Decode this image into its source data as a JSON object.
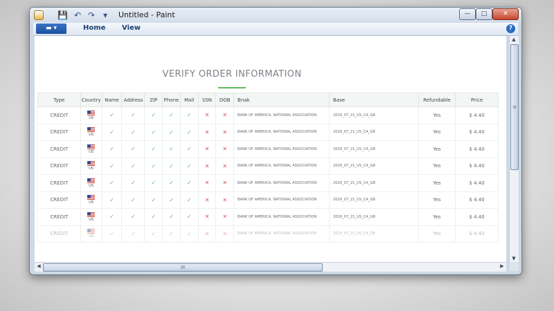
{
  "window": {
    "title": "Untitled - Paint"
  },
  "ribbon": {
    "tabs": [
      "Home",
      "View"
    ],
    "help": "?"
  },
  "qat": {
    "save": "💾",
    "undo": "↶",
    "redo": "↷",
    "customize": "▾"
  },
  "window_buttons": {
    "minimize": "—",
    "maximize": "□",
    "close": "✕"
  },
  "page": {
    "title": "VERIFY ORDER INFORMATION",
    "accent_color": "#5cb85c",
    "columns": [
      "Type",
      "Country",
      "Name",
      "Address",
      "ZIP",
      "Phone",
      "Mail",
      "SSN",
      "DOB",
      "Bnak",
      "Base",
      "Refundable",
      "Price"
    ],
    "rows": [
      {
        "type": "CREDIT",
        "country": "US",
        "bank": "BANK OF AMERICA, NATIONAL ASSOCIATION",
        "base": "2026_07_21_US_CA_GB",
        "refundable": "Yes",
        "price": "$ 4.40"
      },
      {
        "type": "CREDIT",
        "country": "US",
        "bank": "BANK OF AMERICA, NATIONAL ASSOCIATION",
        "base": "2026_07_21_US_CA_GB",
        "refundable": "Yes",
        "price": "$ 4.40"
      },
      {
        "type": "CREDIT",
        "country": "US",
        "bank": "BANK OF AMERICA, NATIONAL ASSOCIATION",
        "base": "2026_07_21_US_CA_GB",
        "refundable": "Yes",
        "price": "$ 4.40"
      },
      {
        "type": "CREDIT",
        "country": "US",
        "bank": "BANK OF AMERICA, NATIONAL ASSOCIATION",
        "base": "2026_07_21_US_CA_GB",
        "refundable": "Yes",
        "price": "$ 4.40"
      },
      {
        "type": "CREDIT",
        "country": "US",
        "bank": "BANK OF AMERICA, NATIONAL ASSOCIATION",
        "base": "2026_07_21_US_CA_GB",
        "refundable": "Yes",
        "price": "$ 4.40"
      },
      {
        "type": "CREDIT",
        "country": "US",
        "bank": "BANK OF AMERICA, NATIONAL ASSOCIATION",
        "base": "2026_07_21_US_CA_GB",
        "refundable": "Yes",
        "price": "$ 4.40"
      },
      {
        "type": "CREDIT",
        "country": "US",
        "bank": "BANK OF AMERICA, NATIONAL ASSOCIATION",
        "base": "2026_07_21_US_CA_GB",
        "refundable": "Yes",
        "price": "$ 4.40"
      },
      {
        "type": "CREDIT",
        "country": "US",
        "bank": "BANK OF AMERICA, NATIONAL ASSOCIATION",
        "base": "2026_07_21_US_CA_GB",
        "refundable": "Yes",
        "price": "$ 4.40"
      }
    ],
    "check_symbol": "✓",
    "cross_symbol": "✕"
  },
  "scroll": {
    "grip": "≡",
    "hgrip": "III"
  }
}
